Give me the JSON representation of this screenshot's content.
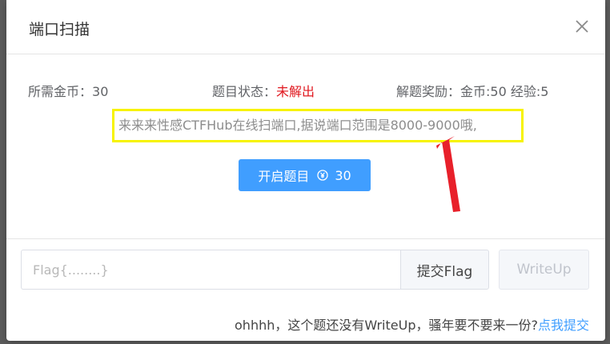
{
  "modal": {
    "title": "端口扫描",
    "close_icon": "close-icon"
  },
  "info": {
    "coins_label": "所需金币：",
    "coins_value": "30",
    "status_label": "题目状态：",
    "status_value": "未解出",
    "reward": "解题奖励：金币:50 经验:5"
  },
  "description": "来来来性感CTFHub在线扫端口,据说端口范围是8000-9000哦,",
  "start_button": {
    "label": "开启题目",
    "icon": "yen-coin-icon",
    "cost": "30"
  },
  "flag_input": {
    "placeholder": "Flag{........}",
    "value": ""
  },
  "submit_button": {
    "label": "提交Flag"
  },
  "writeup_button": {
    "label": "WriteUp"
  },
  "footer": {
    "text": "ohhhh，这个题还没有WriteUp，骚年要不要来一份?",
    "link": "点我提交"
  },
  "colors": {
    "accent": "#409eff",
    "status_red": "#e0181f",
    "highlight_border": "#f7f300",
    "annotation_arrow": "#e8202a"
  }
}
